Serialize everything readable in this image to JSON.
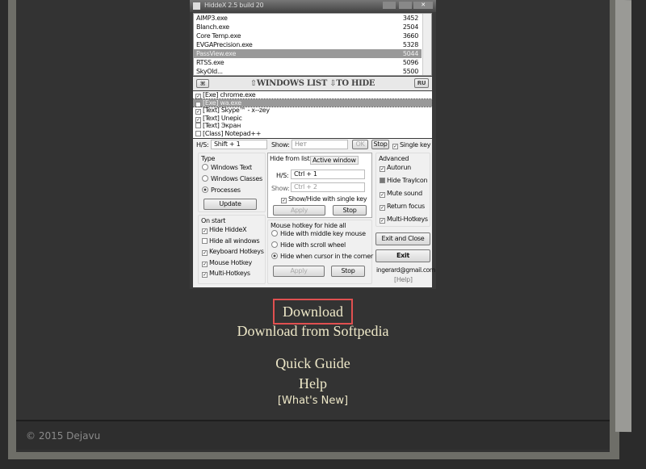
{
  "app": {
    "title": "HiddeX 2.5 build 20",
    "processes": [
      {
        "name": "AIMP3.exe",
        "pid": "3452"
      },
      {
        "name": "Blanch.exe",
        "pid": "2504"
      },
      {
        "name": "Core Temp.exe",
        "pid": "3660"
      },
      {
        "name": "EVGAPrecision.exe",
        "pid": "5328"
      },
      {
        "name": "PassView.exe",
        "pid": "5044",
        "selected": true
      },
      {
        "name": "RTSS.exe",
        "pid": "5096"
      },
      {
        "name": "SkyOld...",
        "pid": "5500"
      }
    ],
    "toolbar": {
      "left_btn": "⌘",
      "label": "⇧WINDOWS LIST ⇩TO HIDE",
      "lang": "RU"
    },
    "hide_list": [
      {
        "label": "[Exe] chrome.exe",
        "checked": true
      },
      {
        "label": "[Exe] wa.exe",
        "checked": true,
        "selected": true
      },
      {
        "label": "[Text] Skype™ - x--zey",
        "checked": true
      },
      {
        "label": "[Text] Unepic",
        "checked": true
      },
      {
        "label": "[Text] Экран",
        "checked": false
      },
      {
        "label": "[Class] Notepad++",
        "checked": false
      }
    ],
    "hs_label": "H/S:",
    "hs_value": "Shift + 1",
    "show_label": "Show:",
    "show_value": "Нет",
    "ok": "OK",
    "stop": "Stop",
    "single_key": "Single key",
    "type": {
      "title": "Type",
      "options": [
        "Windows Text",
        "Windows Classes",
        "Processes"
      ],
      "selected": "Processes",
      "update": "Update"
    },
    "on_start": {
      "title": "On start",
      "items": [
        {
          "label": "Hide HiddeX",
          "checked": true
        },
        {
          "label": "Hide all windows",
          "checked": false
        },
        {
          "label": "Keyboard Hotkeys",
          "checked": true
        },
        {
          "label": "Mouse Hotkey",
          "checked": true
        },
        {
          "label": "Multi-Hotkeys",
          "checked": true
        }
      ]
    },
    "tabs": [
      "Hide from list",
      "Active window"
    ],
    "tab_hs_label": "H/S:",
    "tab_hs": "Ctrl + 1",
    "tab_show_label": "Show:",
    "tab_show": "Ctrl + 2",
    "single_toggle": "Show/Hide with single key",
    "apply": "Apply",
    "tab_stop": "Stop",
    "mouse": {
      "title": "Mouse hotkey for hide all",
      "options": [
        "Hide with middle key mouse",
        "Hide with scroll wheel",
        "Hide when cursor in the corner"
      ],
      "selected": "Hide when cursor in the corner",
      "apply": "Apply",
      "stop": "Stop"
    },
    "advanced": {
      "title": "Advanced",
      "items": [
        {
          "label": "Autorun",
          "checked": true
        },
        {
          "label": "Hide TrayIcon",
          "checked": "partial"
        },
        {
          "label": "Mute sound",
          "checked": true
        },
        {
          "label": "Return focus",
          "checked": true
        },
        {
          "label": "Multi-Hotkeys",
          "checked": true
        }
      ]
    },
    "exit_close": "Exit and Close",
    "exit": "Exit",
    "email": "ingerard@gmail.com",
    "help": "[Help]"
  },
  "links": {
    "download": "Download",
    "softpedia": "Download from Softpedia",
    "guide": "Quick Guide",
    "help": "Help",
    "whats_new": "[What's New]"
  },
  "footer": {
    "copyright": "© 2015 Dejavu"
  },
  "colors": {
    "highlight_border": "#e05050",
    "link": "#eee8c8"
  }
}
